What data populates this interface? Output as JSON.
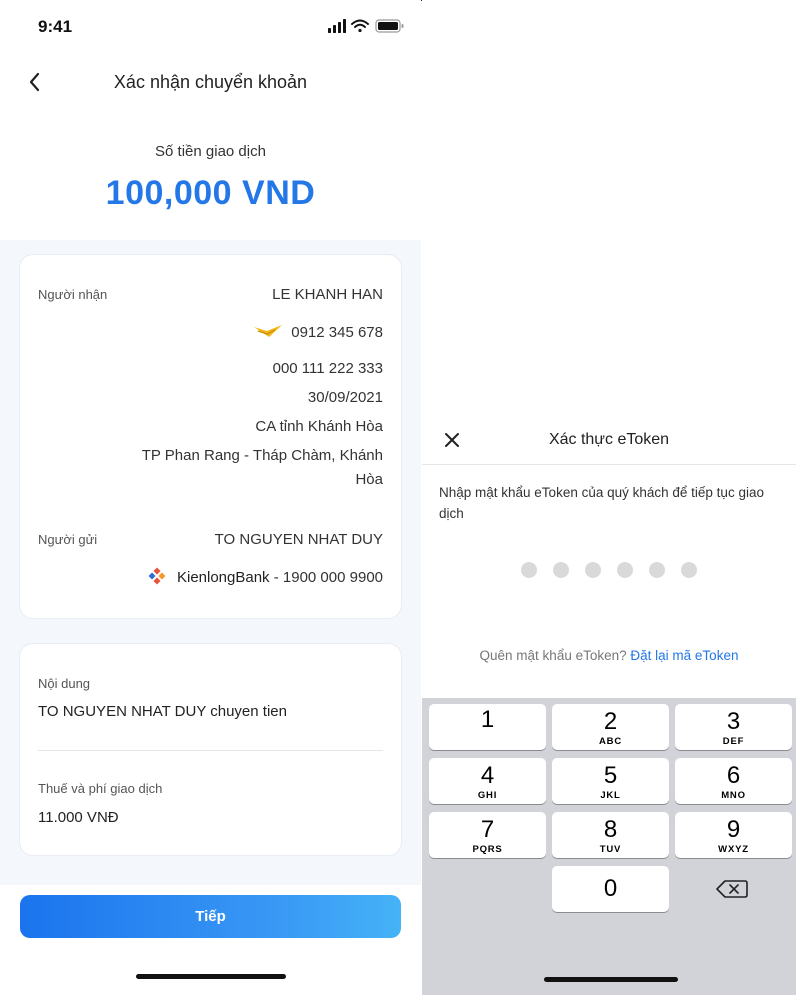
{
  "status_bar": {
    "time": "9:41"
  },
  "header": {
    "title": "Xác nhận chuyển khoản"
  },
  "amount": {
    "label": "Số tiền giao dịch",
    "value": "100,000 VND"
  },
  "recipient": {
    "label": "Người nhận",
    "name": "LE KHANH HAN",
    "phone": "0912 345 678",
    "id_number": "000 111 222 333",
    "issue_date": "30/09/2021",
    "issued_by": "CA tỉnh Khánh Hòa",
    "address_line1": "TP Phan Rang - Tháp Chàm, Khánh",
    "address_line2": "Hòa"
  },
  "sender": {
    "label": "Người gửi",
    "name": "TO NGUYEN NHAT DUY",
    "bank": "KienlongBank",
    "hotline": "- 1900 000 9900"
  },
  "details": {
    "content_label": "Nội dung",
    "content_value": "TO NGUYEN NHAT DUY chuyen tien",
    "fee_label": "Thuế và phí giao dịch",
    "fee_value": "11.000 VNĐ"
  },
  "footer": {
    "next_label": "Tiếp"
  },
  "etoken": {
    "title": "Xác thực eToken",
    "instruction": "Nhập mật khẩu eToken của quý khách để tiếp tục giao dịch",
    "pin_length": 6,
    "forgot_text": "Quên mật khẩu eToken?",
    "reset_link": "Đặt lại mã eToken"
  },
  "keypad": {
    "keys": [
      {
        "digit": "1",
        "letters": ""
      },
      {
        "digit": "2",
        "letters": "ABC"
      },
      {
        "digit": "3",
        "letters": "DEF"
      },
      {
        "digit": "4",
        "letters": "GHI"
      },
      {
        "digit": "5",
        "letters": "JKL"
      },
      {
        "digit": "6",
        "letters": "MNO"
      },
      {
        "digit": "7",
        "letters": "PQRS"
      },
      {
        "digit": "8",
        "letters": "TUV"
      },
      {
        "digit": "9",
        "letters": "WXYZ"
      },
      {
        "digit": "0",
        "letters": ""
      }
    ]
  },
  "colors": {
    "accent": "#2477e6",
    "keypad_bg": "#d1d3d9",
    "card_bg": "#f4f7fb"
  }
}
